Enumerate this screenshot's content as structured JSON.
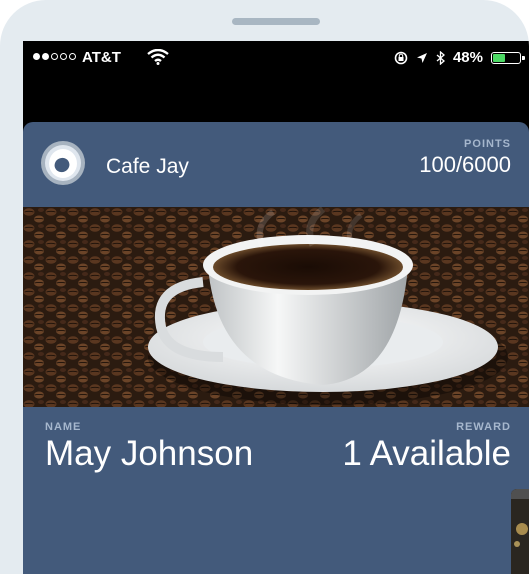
{
  "status_bar": {
    "carrier": "AT&T",
    "signal_dots_filled": 2,
    "signal_dots_total": 5,
    "battery_percent_text": "48%",
    "battery_level": 0.48,
    "battery_color": "#4cd964"
  },
  "pass": {
    "merchant_name": "Cafe Jay",
    "logo_icon": "ring-logo-icon",
    "points_label": "POINTS",
    "points_value": "100/6000",
    "strip_image": "coffee-cup-on-beans",
    "name_label": "NAME",
    "name_value": "May Johnson",
    "reward_label": "REWARD",
    "reward_value": "1 Available",
    "background_color": "#435a7b",
    "label_color": "#a6b7cd"
  }
}
